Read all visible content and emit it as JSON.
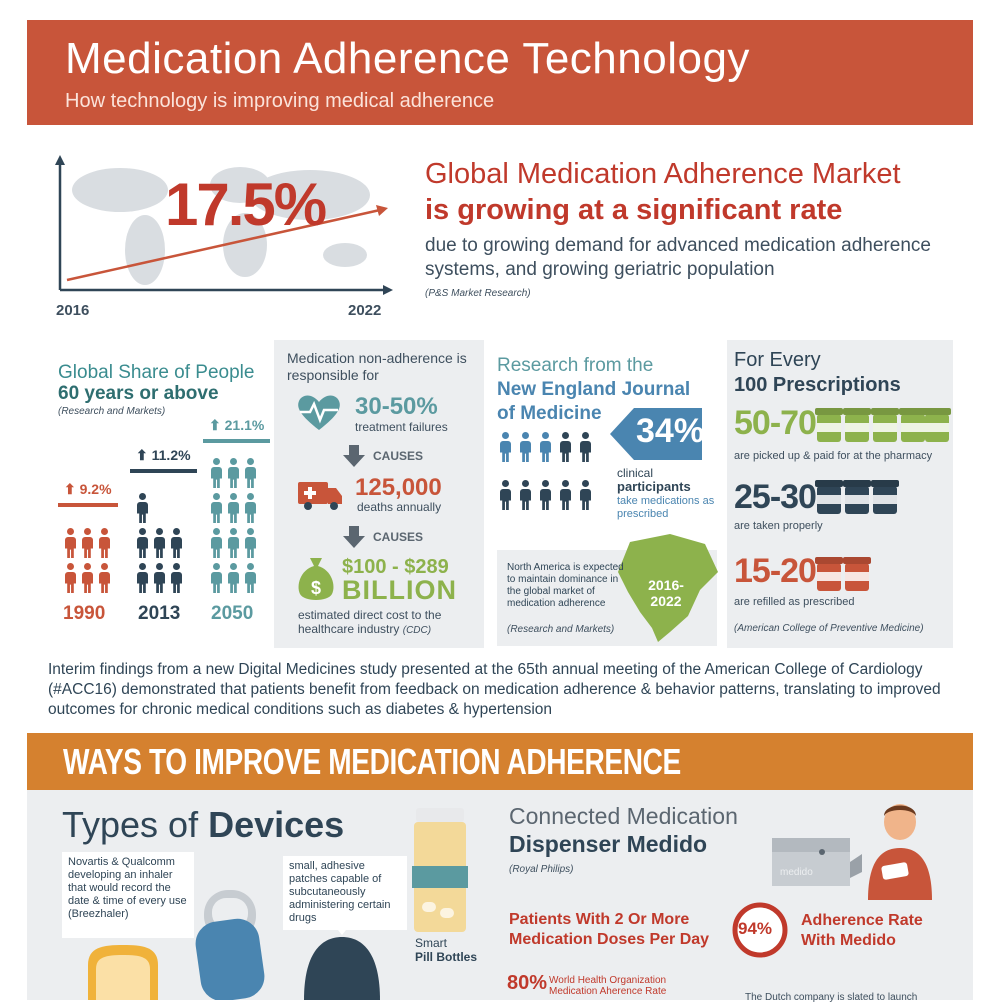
{
  "header": {
    "title": "Medication Adherence Technology",
    "subtitle": "How technology is improving medical adherence"
  },
  "market": {
    "growth_pct": "17.5%",
    "year_start": "2016",
    "year_end": "2022",
    "line1": "Global Medication Adherence Market",
    "line2": "is growing at a significant rate",
    "line3": "due to growing demand for advanced medication adherence systems, and growing geriatric population",
    "source": "(P&S Market Research)"
  },
  "global_share": {
    "title_line1": "Global Share of People",
    "title_line2": "60 years or above",
    "source": "(Research and Markets)",
    "items": [
      {
        "year": "1990",
        "pct": "9.2%",
        "color": "#c8553a"
      },
      {
        "year": "2013",
        "pct": "11.2%",
        "color": "#2f4556"
      },
      {
        "year": "2050",
        "pct": "21.1%",
        "color": "#5b9aa0"
      }
    ]
  },
  "non_adherence": {
    "intro": "Medication non-adherence is responsible for",
    "stat1": "30-50%",
    "stat1_label": "treatment failures",
    "causes1": "CAUSES",
    "stat2": "125,000",
    "stat2_label": "deaths annually",
    "causes2": "CAUSES",
    "stat3_line1": "$100 - $289",
    "stat3_line2": "BILLION",
    "stat3_label": "estimated direct cost to the healthcare industry",
    "stat3_source": "(CDC)"
  },
  "research": {
    "line1": "Research from the",
    "line2": "New England Journal",
    "line3": "of Medicine",
    "pct": "34%",
    "clinical": "clinical",
    "participants": "participants",
    "take": "take medications as prescribed",
    "na_text": "North America is expected to maintain dominance in the global market of medication adherence",
    "na_source": "(Research and Markets)",
    "na_years": "2016-2022"
  },
  "every": {
    "line1": "For Every",
    "line2": "100 Prescriptions",
    "rows": [
      {
        "num": "50-70",
        "text": "are picked up & paid for at the pharmacy",
        "color": "#8db24c"
      },
      {
        "num": "25-30",
        "text": "are taken properly",
        "color": "#2f4556"
      },
      {
        "num": "15-20",
        "text": "are refilled as prescribed",
        "color": "#c8553a"
      }
    ],
    "source": "(American College of Preventive Medicine)"
  },
  "interim": "Interim findings from a new Digital Medicines study presented at the 65th annual meeting of the American College of Cardiology (#ACC16) demonstrated that patients benefit from feedback on medication adherence & behavior patterns, translating to improved outcomes for chronic medical conditions such as diabetes & hypertension",
  "ways": {
    "title": "WAYS TO IMPROVE MEDICATION ADHERENCE",
    "devices_prefix": "Types of ",
    "devices_bold": "Devices",
    "inhaler_text": "Novartis & Qualcomm developing an inhaler that would record the date & time of every use (Breezhaler)",
    "patch_text": "small, adhesive patches capable of subcutaneously administering certain drugs",
    "smart_line1": "Smart",
    "smart_line2": "Pill Bottles",
    "medido_line1": "Connected Medication",
    "medido_line2": "Dispenser Medido",
    "medido_source": "(Royal Philips)",
    "medido_device": "medido",
    "patients_text": "Patients With 2 Or More Medication Doses Per Day",
    "adherence_pct": "94%",
    "adherence_text": "Adherence Rate With Medido",
    "who_pct": "80%",
    "who_text": "World Health Organization Medication Aherence Rate",
    "dutch_text": "The Dutch company is slated to launch"
  }
}
